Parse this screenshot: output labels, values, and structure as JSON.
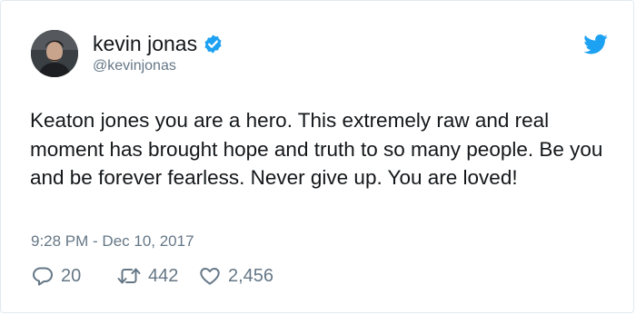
{
  "author": {
    "display_name": "kevin jonas",
    "handle": "@kevinjonas",
    "verified": true,
    "avatar_icon": "profile-photo"
  },
  "brand": {
    "icon": "twitter-bird-icon",
    "color": "#1da1f2"
  },
  "tweet": {
    "text": "Keaton jones you are a hero. This extremely raw and real moment has brought hope and truth to so many people. Be you and be forever fearless. Never give up. You are loved!",
    "timestamp": "9:28 PM - Dec 10, 2017"
  },
  "actions": {
    "replies": "20",
    "retweets": "442",
    "likes": "2,456"
  },
  "colors": {
    "text": "#14171a",
    "secondary": "#657786",
    "verified_badge": "#1da1f2",
    "border": "#e1e8ed"
  }
}
